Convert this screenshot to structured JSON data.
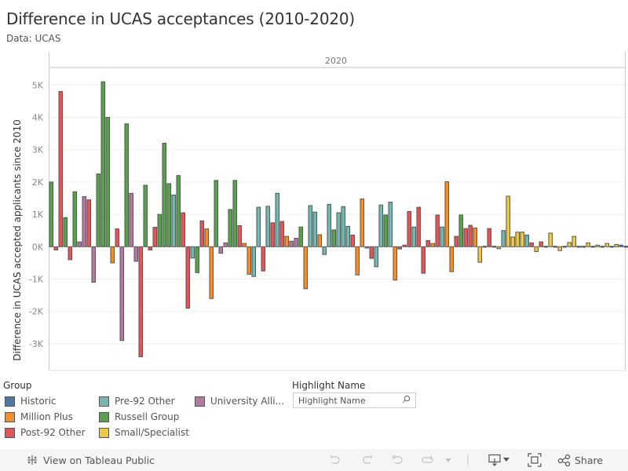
{
  "header": {
    "title": "Difference in UCAS acceptances (2010-2020)",
    "subtitle": "Data: UCAS"
  },
  "chart_data": {
    "type": "bar",
    "title": "Difference in UCAS acceptances (2010-2020)",
    "column_header": "2020",
    "xlabel": "",
    "ylabel": "Difference in UCAS accepted applicants since 2010",
    "ylim": [
      -3.8,
      5.5
    ],
    "yticks": [
      5,
      4,
      3,
      2,
      1,
      0,
      -1,
      -2,
      -3
    ],
    "ytick_labels": [
      "5K",
      "4K",
      "3K",
      "2K",
      "1K",
      "0K",
      "-1K",
      "-2K",
      "-3K"
    ],
    "grid": true,
    "units": "thousands",
    "group_colors": {
      "Historic": "#4e79a7",
      "Million Plus": "#f28e2b",
      "Post-92 Other": "#e15759",
      "Pre-92 Other": "#76b7b2",
      "Russell Group": "#59a14f",
      "Small/Specialist": "#edc948",
      "University Alliance": "#b07aa1",
      "Unknown": "#555555"
    },
    "bars": [
      {
        "g": "Russell Group",
        "v": 2.0
      },
      {
        "g": "Post-92 Other",
        "v": -0.1
      },
      {
        "g": "Post-92 Other",
        "v": 4.8
      },
      {
        "g": "Russell Group",
        "v": 0.9
      },
      {
        "g": "Post-92 Other",
        "v": -0.4
      },
      {
        "g": "Russell Group",
        "v": 1.7
      },
      {
        "g": "University Alliance",
        "v": 0.15
      },
      {
        "g": "University Alliance",
        "v": 1.55
      },
      {
        "g": "Post-92 Other",
        "v": 1.45
      },
      {
        "g": "University Alliance",
        "v": -1.1
      },
      {
        "g": "Russell Group",
        "v": 2.25
      },
      {
        "g": "Russell Group",
        "v": 5.1
      },
      {
        "g": "Russell Group",
        "v": 4.0
      },
      {
        "g": "Million Plus",
        "v": -0.5
      },
      {
        "g": "Post-92 Other",
        "v": 0.55
      },
      {
        "g": "University Alliance",
        "v": -2.9
      },
      {
        "g": "Russell Group",
        "v": 3.8
      },
      {
        "g": "University Alliance",
        "v": 1.65
      },
      {
        "g": "University Alliance",
        "v": -0.45
      },
      {
        "g": "Post-92 Other",
        "v": -3.4
      },
      {
        "g": "Russell Group",
        "v": 1.9
      },
      {
        "g": "Post-92 Other",
        "v": -0.1
      },
      {
        "g": "Post-92 Other",
        "v": 0.6
      },
      {
        "g": "Russell Group",
        "v": 1.0
      },
      {
        "g": "Russell Group",
        "v": 3.2
      },
      {
        "g": "Russell Group",
        "v": 1.95
      },
      {
        "g": "Pre-92 Other",
        "v": 1.6
      },
      {
        "g": "Russell Group",
        "v": 2.2
      },
      {
        "g": "Post-92 Other",
        "v": 1.05
      },
      {
        "g": "Post-92 Other",
        "v": -1.9
      },
      {
        "g": "Pre-92 Other",
        "v": -0.35
      },
      {
        "g": "Russell Group",
        "v": -0.8
      },
      {
        "g": "Post-92 Other",
        "v": 0.8
      },
      {
        "g": "Million Plus",
        "v": 0.55
      },
      {
        "g": "Million Plus",
        "v": -1.6
      },
      {
        "g": "Russell Group",
        "v": 2.05
      },
      {
        "g": "University Alliance",
        "v": -0.2
      },
      {
        "g": "University Alliance",
        "v": 0.12
      },
      {
        "g": "Russell Group",
        "v": 1.15
      },
      {
        "g": "Russell Group",
        "v": 2.05
      },
      {
        "g": "Post-92 Other",
        "v": 0.65
      },
      {
        "g": "Million Plus",
        "v": 0.1
      },
      {
        "g": "Million Plus",
        "v": -0.85
      },
      {
        "g": "Pre-92 Other",
        "v": -0.92
      },
      {
        "g": "Pre-92 Other",
        "v": 1.22
      },
      {
        "g": "Post-92 Other",
        "v": -0.75
      },
      {
        "g": "Pre-92 Other",
        "v": 1.25
      },
      {
        "g": "Post-92 Other",
        "v": 0.74
      },
      {
        "g": "Pre-92 Other",
        "v": 1.65
      },
      {
        "g": "Post-92 Other",
        "v": 0.78
      },
      {
        "g": "Million Plus",
        "v": 0.32
      },
      {
        "g": "University Alliance",
        "v": 0.17
      },
      {
        "g": "University Alliance",
        "v": 0.26
      },
      {
        "g": "Russell Group",
        "v": 0.61
      },
      {
        "g": "Million Plus",
        "v": -1.3
      },
      {
        "g": "Pre-92 Other",
        "v": 1.27
      },
      {
        "g": "Pre-92 Other",
        "v": 1.07
      },
      {
        "g": "Million Plus",
        "v": 0.37
      },
      {
        "g": "Pre-92 Other",
        "v": -0.24
      },
      {
        "g": "Pre-92 Other",
        "v": 1.31
      },
      {
        "g": "Russell Group",
        "v": 0.52
      },
      {
        "g": "Pre-92 Other",
        "v": 1.05
      },
      {
        "g": "Pre-92 Other",
        "v": 1.24
      },
      {
        "g": "Pre-92 Other",
        "v": 0.63
      },
      {
        "g": "Post-92 Other",
        "v": 0.36
      },
      {
        "g": "Million Plus",
        "v": -0.87
      },
      {
        "g": "Million Plus",
        "v": 1.48
      },
      {
        "g": "Pre-92 Other",
        "v": -0.04
      },
      {
        "g": "Post-92 Other",
        "v": -0.36
      },
      {
        "g": "Pre-92 Other",
        "v": -0.62
      },
      {
        "g": "Pre-92 Other",
        "v": 1.29
      },
      {
        "g": "Russell Group",
        "v": 0.98
      },
      {
        "g": "Pre-92 Other",
        "v": 1.38
      },
      {
        "g": "Million Plus",
        "v": -1.03
      },
      {
        "g": "Post-92 Other",
        "v": -0.07
      },
      {
        "g": "Post-92 Other",
        "v": 0.05
      },
      {
        "g": "Post-92 Other",
        "v": 1.09
      },
      {
        "g": "Pre-92 Other",
        "v": 0.61
      },
      {
        "g": "Post-92 Other",
        "v": 1.22
      },
      {
        "g": "Post-92 Other",
        "v": -0.82
      },
      {
        "g": "Post-92 Other",
        "v": 0.19
      },
      {
        "g": "Million Plus",
        "v": 0.1
      },
      {
        "g": "Post-92 Other",
        "v": 0.98
      },
      {
        "g": "Pre-92 Other",
        "v": 0.61
      },
      {
        "g": "Million Plus",
        "v": 2.01
      },
      {
        "g": "Million Plus",
        "v": -0.77
      },
      {
        "g": "Post-92 Other",
        "v": 0.32
      },
      {
        "g": "Russell Group",
        "v": 0.98
      },
      {
        "g": "Post-92 Other",
        "v": 0.56
      },
      {
        "g": "Post-92 Other",
        "v": 0.66
      },
      {
        "g": "Million Plus",
        "v": 0.58
      },
      {
        "g": "Small/Specialist",
        "v": -0.48
      },
      {
        "g": "Unknown",
        "v": 0.02
      },
      {
        "g": "Post-92 Other",
        "v": 0.56
      },
      {
        "g": "Unknown",
        "v": 0.02
      },
      {
        "g": "Small/Specialist",
        "v": -0.06
      },
      {
        "g": "Pre-92 Other",
        "v": 0.5
      },
      {
        "g": "Small/Specialist",
        "v": 1.56
      },
      {
        "g": "Small/Specialist",
        "v": 0.3
      },
      {
        "g": "Small/Specialist",
        "v": 0.45
      },
      {
        "g": "Small/Specialist",
        "v": 0.45
      },
      {
        "g": "Pre-92 Other",
        "v": 0.36
      },
      {
        "g": "Post-92 Other",
        "v": 0.12
      },
      {
        "g": "Small/Specialist",
        "v": -0.15
      },
      {
        "g": "Post-92 Other",
        "v": 0.15
      },
      {
        "g": "Unknown",
        "v": 0.02
      },
      {
        "g": "Small/Specialist",
        "v": 0.42
      },
      {
        "g": "Unknown",
        "v": 0.01
      },
      {
        "g": "Small/Specialist",
        "v": -0.12
      },
      {
        "g": "Unknown",
        "v": 0.02
      },
      {
        "g": "Small/Specialist",
        "v": 0.13
      },
      {
        "g": "Small/Specialist",
        "v": 0.32
      },
      {
        "g": "Unknown",
        "v": 0.01
      },
      {
        "g": "Unknown",
        "v": 0.01
      },
      {
        "g": "Small/Specialist",
        "v": 0.12
      },
      {
        "g": "Unknown",
        "v": 0.01
      },
      {
        "g": "Small/Specialist",
        "v": 0.05
      },
      {
        "g": "Unknown",
        "v": 0.01
      },
      {
        "g": "Small/Specialist",
        "v": 0.1
      },
      {
        "g": "Unknown",
        "v": 0.01
      },
      {
        "g": "Small/Specialist",
        "v": 0.07
      },
      {
        "g": "Historic",
        "v": 0.05
      },
      {
        "g": "Unknown",
        "v": 0.01
      }
    ]
  },
  "legend": {
    "title": "Group",
    "items": [
      {
        "label": "Historic",
        "color": "#4e79a7"
      },
      {
        "label": "Million Plus",
        "color": "#f28e2b"
      },
      {
        "label": "Post-92 Other",
        "color": "#e15759"
      },
      {
        "label": "Pre-92 Other",
        "color": "#76b7b2"
      },
      {
        "label": "Russell Group",
        "color": "#59a14f"
      },
      {
        "label": "Small/Specialist",
        "color": "#edc948"
      },
      {
        "label": "University Alli...",
        "color": "#b07aa1"
      }
    ]
  },
  "highlight": {
    "title": "Highlight Name",
    "placeholder": "Highlight Name",
    "icon": "search-icon"
  },
  "footer": {
    "view_link": "View on Tableau Public",
    "share_label": "Share",
    "icons": [
      "undo-icon",
      "redo-icon",
      "revert-icon",
      "refresh-icon",
      "dropdown-caret-icon",
      "download-icon",
      "fullscreen-icon",
      "share-icon"
    ]
  }
}
